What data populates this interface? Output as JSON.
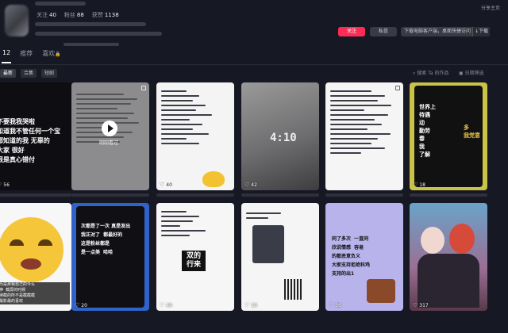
{
  "profile": {
    "stats": [
      {
        "label": "关注",
        "value": "40"
      },
      {
        "label": "粉丝",
        "value": "88"
      },
      {
        "label": "获赞",
        "value": "1138"
      }
    ],
    "share_label": "分享主页",
    "follow_label": "关注",
    "message_label": "私信",
    "install_label": "下载电脑客户端，桌面快捷访问",
    "download_label": "下载"
  },
  "tabs": [
    {
      "label": "12"
    },
    {
      "label": "推荐"
    },
    {
      "label": "喜欢"
    }
  ],
  "filters": [
    "最新",
    "合集",
    "短剧"
  ],
  "search_placeholder": "搜索 Ta 的作品",
  "sort_label": "日期筛选",
  "videos": [
    {
      "likes": "56",
      "caption": "不要我我哭啦\n知道我不管任何一个宝\n都知道的我 无辜的\n大家 很好\n很是真心错付"
    },
    {
      "likes": "",
      "caption": "刚刚看过"
    },
    {
      "likes": "40",
      "caption": ""
    },
    {
      "likes": "42",
      "caption": "4:10"
    },
    {
      "likes": "",
      "caption": ""
    },
    {
      "likes": "18",
      "caption": "世界上\n待遇\n动\n勤劳\n春\n我\n了解",
      "caption2": "多\n我党意"
    },
    {
      "likes": "",
      "caption": "以为是那我自己的今么\n萌神  截屏的时候\n连续截的所不是截截截\n了最影最的喜欢"
    },
    {
      "likes": "20",
      "caption": "次都是了一次 真是发出\n我正对了  都最好的\n这是粉丝都是\n是一点美  哈哈"
    },
    {
      "likes": "40",
      "caption": "双的\n行来"
    },
    {
      "likes": "19",
      "caption": ""
    },
    {
      "likes": "36",
      "caption": "同了多次  一直同\n欣说情感  容易\n的都恶意负义\n大家支持拒绝科鸡\n支持的出1"
    },
    {
      "likes": "317",
      "caption": ""
    }
  ],
  "colors": {
    "accent": "#fe2c55",
    "background": "#161823"
  }
}
